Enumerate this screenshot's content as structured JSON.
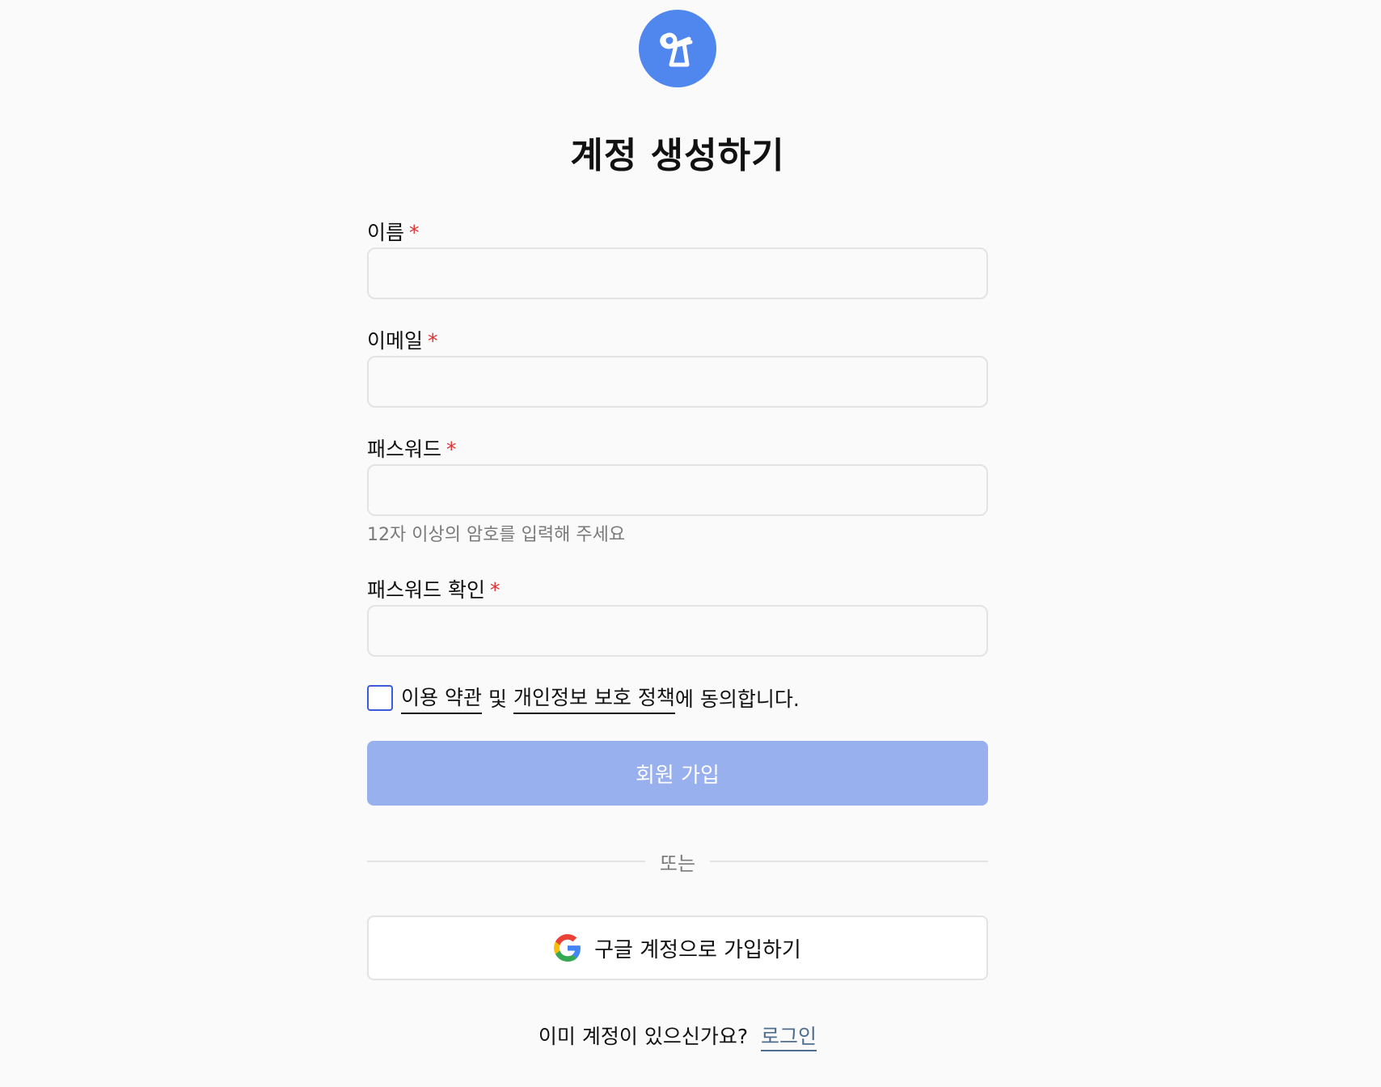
{
  "brand": {
    "logo_color": "#4f87ee"
  },
  "form": {
    "title": "계정 생성하기",
    "required_mark": "*",
    "name_label": "이름",
    "name_value": "",
    "email_label": "이메일",
    "email_value": "",
    "password_label": "패스워드",
    "password_value": "",
    "password_hint": "12자 이상의 암호를 입력해 주세요",
    "confirm_label": "패스워드 확인",
    "confirm_value": "",
    "agree_checked": false,
    "agree_terms_link": "이용 약관",
    "agree_and": "및",
    "agree_privacy_link": "개인정보 보호 정책",
    "agree_suffix": "에 동의합니다.",
    "submit_label": "회원 가입",
    "divider_text": "또는",
    "google_label": "구글 계정으로 가입하기",
    "footer_text": "이미 계정이 있으신가요?",
    "login_link": "로그인"
  },
  "colors": {
    "accent": "#4f87ee",
    "submit_disabled": "#99b0ee",
    "required": "#e03131",
    "checkbox_border": "#3b5bdb"
  }
}
